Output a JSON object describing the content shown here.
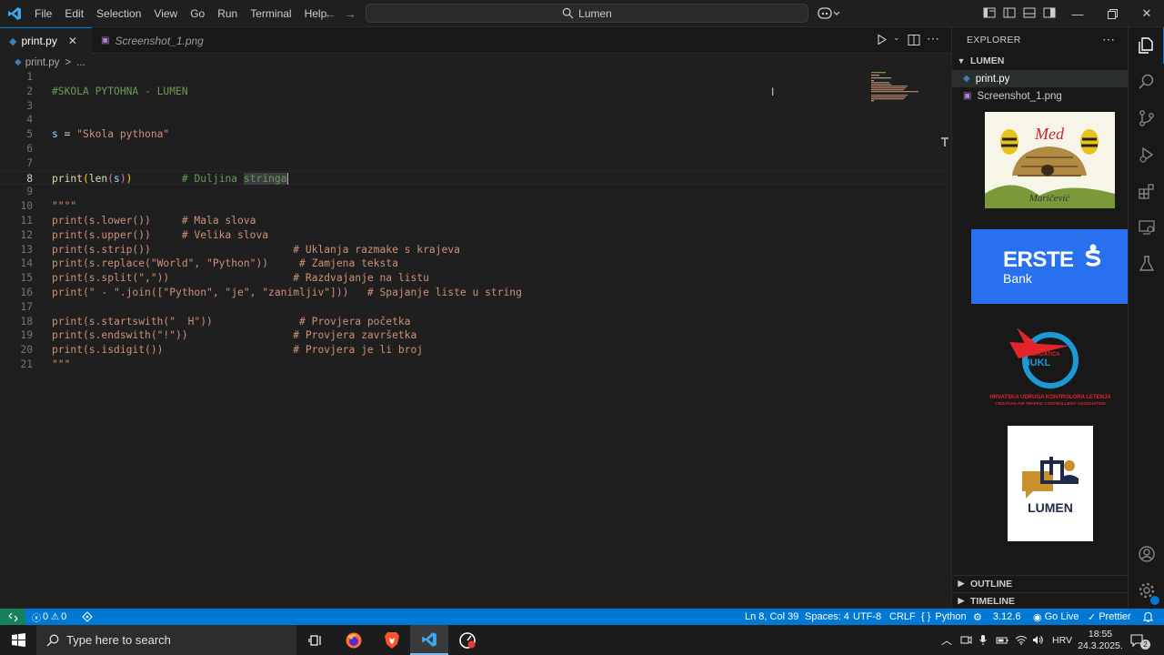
{
  "menu": [
    "File",
    "Edit",
    "Selection",
    "View",
    "Go",
    "Run",
    "Terminal",
    "Help"
  ],
  "search": {
    "text": "Lumen"
  },
  "tabs": [
    {
      "label": "print.py",
      "active": true
    },
    {
      "label": "Screenshot_1.png",
      "active": false
    }
  ],
  "breadcrumb": {
    "file": "print.py",
    "sep": ">",
    "more": "..."
  },
  "code_lines": [
    {
      "n": "1",
      "parts": []
    },
    {
      "n": "2",
      "parts": [
        {
          "t": "#SKOLA PYTOHNA - LUMEN",
          "c": "cmt"
        }
      ]
    },
    {
      "n": "3",
      "parts": []
    },
    {
      "n": "4",
      "parts": []
    },
    {
      "n": "5",
      "parts": [
        {
          "t": "s",
          "c": "var"
        },
        {
          "t": " = ",
          "c": "plain"
        },
        {
          "t": "\"Skola pythona\"",
          "c": "str"
        }
      ]
    },
    {
      "n": "6",
      "parts": []
    },
    {
      "n": "7",
      "parts": []
    },
    {
      "n": "8",
      "parts": [
        {
          "t": "print",
          "c": "fn"
        },
        {
          "t": "(",
          "c": "br1"
        },
        {
          "t": "len",
          "c": "fn"
        },
        {
          "t": "(",
          "c": "br2"
        },
        {
          "t": "s",
          "c": "var"
        },
        {
          "t": ")",
          "c": "br2"
        },
        {
          "t": ")",
          "c": "br1"
        },
        {
          "t": "        # Duljina ",
          "c": "cmt"
        },
        {
          "t": "stringa",
          "c": "cmt sel"
        }
      ]
    },
    {
      "n": "9",
      "parts": []
    },
    {
      "n": "10",
      "parts": [
        {
          "t": "\"\"\"\"",
          "c": "str"
        }
      ]
    },
    {
      "n": "11",
      "parts": [
        {
          "t": "print(s.lower())     # Mala slova",
          "c": "str"
        }
      ]
    },
    {
      "n": "12",
      "parts": [
        {
          "t": "print(s.upper())     # Velika slova",
          "c": "str"
        }
      ]
    },
    {
      "n": "13",
      "parts": [
        {
          "t": "print(s.strip())                       # Uklanja razmake s krajeva",
          "c": "str"
        }
      ]
    },
    {
      "n": "14",
      "parts": [
        {
          "t": "print(s.replace(\"World\", \"Python\"))     # Zamjena teksta",
          "c": "str"
        }
      ]
    },
    {
      "n": "15",
      "parts": [
        {
          "t": "print(s.split(\",\"))                    # Razdvajanje na listu",
          "c": "str"
        }
      ]
    },
    {
      "n": "16",
      "parts": [
        {
          "t": "print(\" - \".join([\"Python\", \"je\", \"zanimljiv\"]))   # Spajanje liste u string",
          "c": "str"
        }
      ]
    },
    {
      "n": "17",
      "parts": []
    },
    {
      "n": "18",
      "parts": [
        {
          "t": "print(s.startswith(\"  H\"))              # Provjera početka",
          "c": "str"
        }
      ]
    },
    {
      "n": "19",
      "parts": [
        {
          "t": "print(s.endswith(\"!\"))                 # Provjera završetka",
          "c": "str"
        }
      ]
    },
    {
      "n": "20",
      "parts": [
        {
          "t": "print(s.isdigit())                     # Provjera je li broj",
          "c": "str"
        }
      ]
    },
    {
      "n": "21",
      "parts": [
        {
          "t": "\"\"\"",
          "c": "str"
        }
      ]
    }
  ],
  "current_line": "8",
  "explorer": {
    "title": "EXPLORER",
    "folder": "LUMEN",
    "files": [
      "print.py",
      "Screenshot_1.png"
    ],
    "outline": "OUTLINE",
    "timeline": "TIMELINE"
  },
  "image_preview": {
    "med_logo": "Med Maričević",
    "erste": {
      "line1": "ERSTE",
      "line2": "Bank"
    },
    "hukl": {
      "small": "CROATICA",
      "main": "HUKL",
      "line1": "HRVATSKA UDRUGA KONTROLORA LETENJA",
      "line2": "CROATIAN AIR TRAFFIC CONTROLLERS' ASSOCIATION"
    },
    "lumen": "LUMEN"
  },
  "status": {
    "errors": "0",
    "warnings": "0",
    "position": "Ln 8, Col 39",
    "spaces": "Spaces: 4",
    "encoding": "UTF-8",
    "eol": "CRLF",
    "language": "Python",
    "version": "3.12.6",
    "golive": "Go Live",
    "prettier": "Prettier"
  },
  "taskbar": {
    "search_placeholder": "Type here to search",
    "lang": "HRV",
    "time": "18:55",
    "date": "24.3.2025.",
    "notif": "2"
  },
  "colors": {
    "accent": "#0078d4",
    "erste": "#2870ed",
    "hukl_red": "#e3242b",
    "hukl_blue": "#1c9ad6",
    "lumen_gold": "#c8912e",
    "lumen_navy": "#1f2a4a"
  }
}
